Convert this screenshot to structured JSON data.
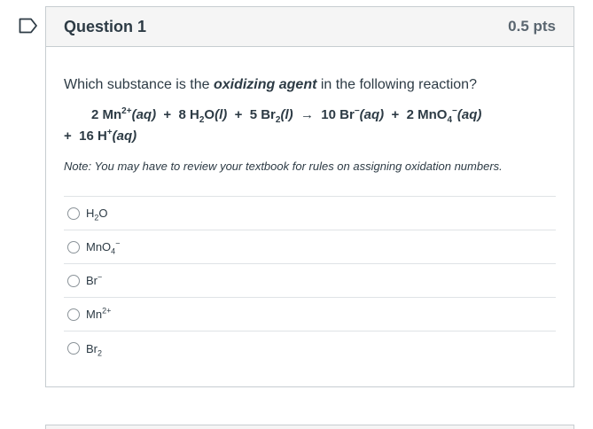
{
  "question": {
    "title": "Question 1",
    "points": "0.5 pts",
    "prompt_before": "Which substance is the ",
    "prompt_emphasis": "oxidizing agent",
    "prompt_after": " in the following reaction?",
    "note": "Note:  You may have to review your textbook for rules on assigning oxidation numbers."
  },
  "reaction": {
    "t1": "2 Mn",
    "t1_sup": "2+",
    "t1_state": "(aq)",
    "plus1": "  +  ",
    "t2": "8 H",
    "t2_sub": "2",
    "t2b": "O",
    "t2_state": "(l)",
    "plus2": "  +  ",
    "t3": "5 Br",
    "t3_sub": "2",
    "t3_state": "(l)",
    "arrow": "  →  ",
    "t4": "10 Br",
    "t4_sup": "−",
    "t4_state": "(aq)",
    "plus3": "  +  ",
    "t5": "2 MnO",
    "t5_sub": "4",
    "t5_sup": "−",
    "t5_state": "(aq)",
    "plus4": "+  ",
    "t6": "16 H",
    "t6_sup": "+",
    "t6_state": "(aq)"
  },
  "answers": [
    {
      "base": "H",
      "sub": "2",
      "tail": "O",
      "sup": ""
    },
    {
      "base": "MnO",
      "sub": "4",
      "tail": "",
      "sup": "−"
    },
    {
      "base": "Br",
      "sub": "",
      "tail": "",
      "sup": "−"
    },
    {
      "base": "Mn",
      "sub": "",
      "tail": "",
      "sup": "2+"
    },
    {
      "base": "Br",
      "sub": "2",
      "tail": "",
      "sup": ""
    }
  ],
  "colors": {
    "border": "#c7cdd1",
    "header_bg": "#f5f5f5",
    "text": "#2d3b45"
  },
  "icons": {
    "flag": "bookmark-flag-icon"
  }
}
